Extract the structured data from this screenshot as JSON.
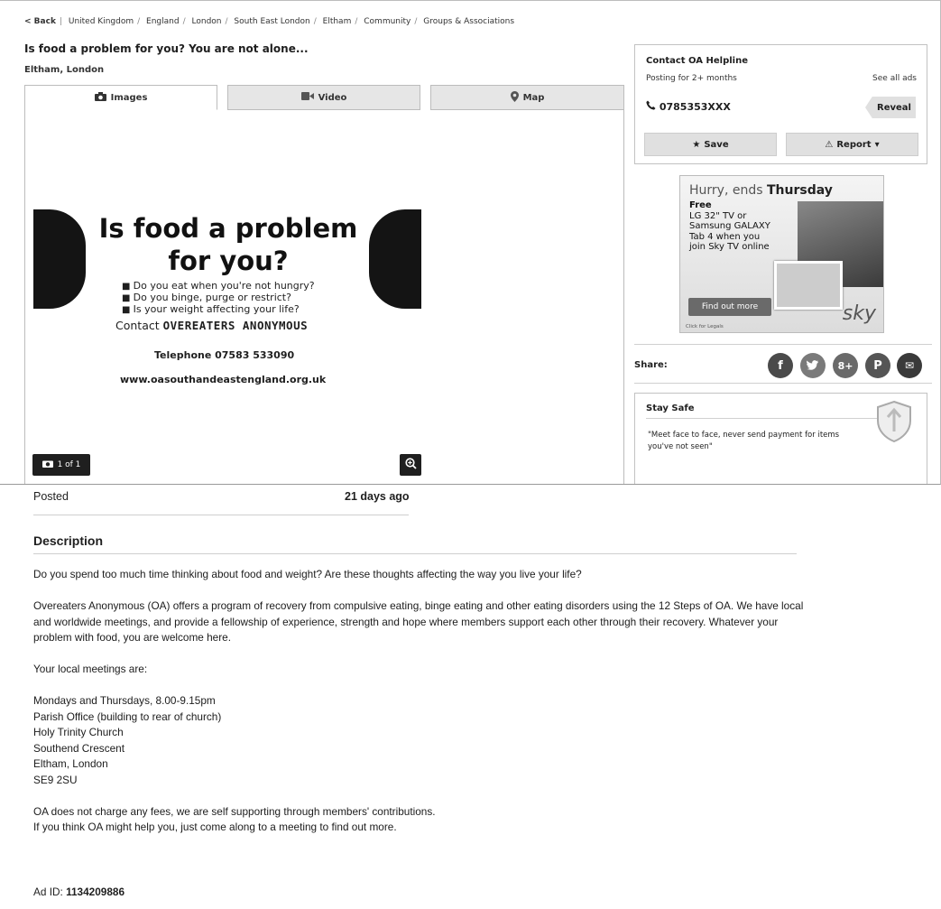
{
  "breadcrumb": {
    "back": "< Back",
    "items": [
      "United Kingdom",
      "England",
      "London",
      "South East London",
      "Eltham",
      "Community",
      "Groups & Associations"
    ]
  },
  "listing": {
    "title": "Is food a problem for you? You are not alone...",
    "location": "Eltham, London"
  },
  "tabs": [
    {
      "label": "Images",
      "icon": "camera-icon"
    },
    {
      "label": "Video",
      "icon": "video-camera-icon"
    },
    {
      "label": "Map",
      "icon": "map-pin-icon"
    }
  ],
  "ad_image": {
    "headline_1": "Is food a problem",
    "headline_2": "for you?",
    "bullets": [
      "Do you eat when you're not hungry?",
      "Do you binge, purge or restrict?",
      "Is your weight affecting your life?"
    ],
    "contact_prefix": "Contact",
    "contact_org": "OVEREATERS ANONYMOUS",
    "telephone": "Telephone 07583 533090",
    "website": "www.oasouthandeastengland.org.uk"
  },
  "gallery": {
    "counter": "1 of 1",
    "counter_icon": "camera-icon",
    "zoom_icon": "zoom-in-icon"
  },
  "contact": {
    "name": "Contact OA Helpline",
    "posting": "Posting for 2+ months",
    "see_all": "See all ads",
    "phone": "0785353XXX",
    "reveal": "Reveal",
    "save": "Save",
    "report": "Report"
  },
  "banner": {
    "hurry": "Hurry, ends",
    "hurry_day": "Thursday",
    "free": "Free",
    "offer_lines": [
      "LG 32\" TV or",
      "Samsung GALAXY",
      "Tab 4 when you",
      "join Sky TV online"
    ],
    "cta": "Find out more",
    "legals": "Click for Legals",
    "brand": "sky"
  },
  "share": {
    "label": "Share:",
    "icons": [
      {
        "name": "facebook-icon",
        "glyph": "f"
      },
      {
        "name": "twitter-icon",
        "glyph": "t"
      },
      {
        "name": "google-plus-icon",
        "glyph": "8+"
      },
      {
        "name": "pinterest-icon",
        "glyph": "P"
      },
      {
        "name": "email-icon",
        "glyph": "✉"
      }
    ]
  },
  "stay_safe": {
    "title": "Stay Safe",
    "quote": "\"Meet face to face, never send payment for items you've not seen\""
  },
  "details": {
    "posted_label": "Posted",
    "posted_value": "21 days ago",
    "description_heading": "Description",
    "paragraphs": [
      "Do you spend too much time thinking about food and weight? Are these thoughts affecting the way you live your life?",
      "Overeaters Anonymous (OA) offers a program of recovery from compulsive eating, binge eating and other eating disorders using the 12 Steps of OA. We have local and worldwide meetings, and provide a fellowship of experience, strength and hope where members support each other through their recovery. Whatever your problem with food, you are welcome here.",
      "Your local meetings are:"
    ],
    "address_lines": [
      "Mondays and Thursdays, 8.00-9.15pm",
      "Parish Office (building to rear of church)",
      "Holy Trinity Church",
      "Southend Crescent",
      "Eltham, London",
      "SE9 2SU"
    ],
    "closing_lines": [
      "OA does not charge any fees, we are self supporting through members' contributions.",
      "If you think OA might help you, just come along to a meeting to find out more."
    ],
    "ad_id_label": "Ad ID:",
    "ad_id_value": "1134209886"
  }
}
